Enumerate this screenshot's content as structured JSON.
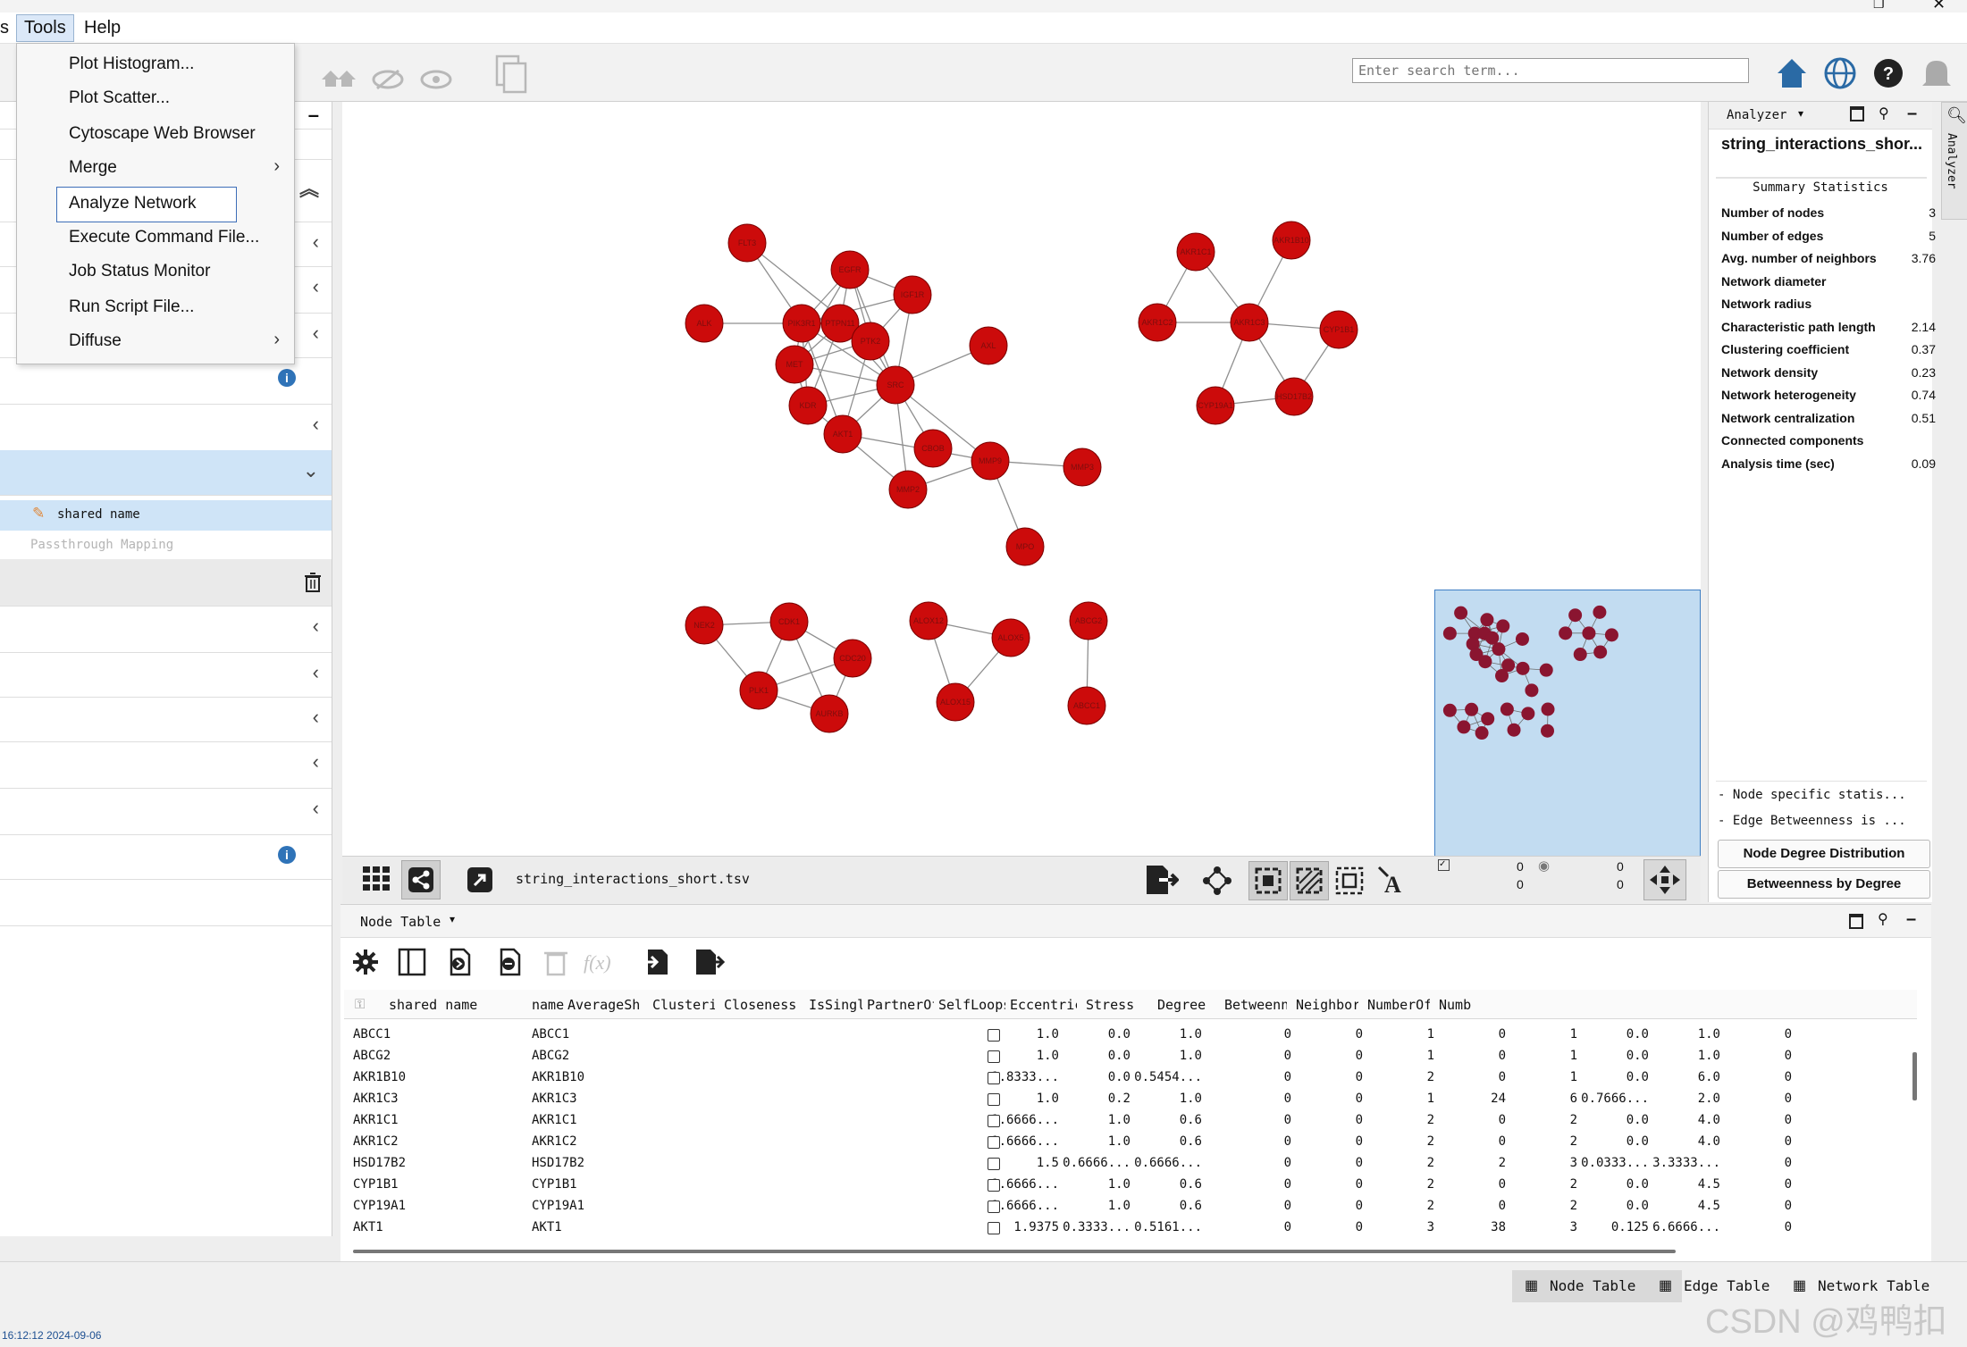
{
  "menubar": {
    "cut_item": "s",
    "tools": "Tools",
    "help": "Help"
  },
  "tools_menu": {
    "items": [
      {
        "label": "Plot Histogram..."
      },
      {
        "label": "Plot Scatter..."
      },
      {
        "label": "Cytoscape Web Browser"
      },
      {
        "label": "Merge"
      },
      {
        "label": "Analyze Network"
      },
      {
        "label": "Execute Command File..."
      },
      {
        "label": "Job Status Monitor"
      },
      {
        "label": "Run Script File..."
      },
      {
        "label": "Diffuse"
      }
    ]
  },
  "search": {
    "placeholder": "Enter search term..."
  },
  "left_panel": {
    "selected_column": "shared name",
    "mapping_type": "Passthrough Mapping"
  },
  "network": {
    "file_label": "string_interactions_short.tsv",
    "nodes": [
      {
        "id": "FLT3"
      },
      {
        "id": "EGFR"
      },
      {
        "id": "IGF1R"
      },
      {
        "id": "ALK"
      },
      {
        "id": "PIK3R1"
      },
      {
        "id": "PTPN11"
      },
      {
        "id": "PTK2"
      },
      {
        "id": "AXL"
      },
      {
        "id": "MET"
      },
      {
        "id": "SRC"
      },
      {
        "id": "KDR"
      },
      {
        "id": "AKT1"
      },
      {
        "id": "CBOB"
      },
      {
        "id": "MMP9"
      },
      {
        "id": "MMP2"
      },
      {
        "id": "MMP3"
      },
      {
        "id": "MPO"
      },
      {
        "id": "AKR1C1"
      },
      {
        "id": "AKR1B10"
      },
      {
        "id": "AKR1C2"
      },
      {
        "id": "AKR1C3"
      },
      {
        "id": "CYP1B1"
      },
      {
        "id": "CYP19A1"
      },
      {
        "id": "HSD17B2"
      },
      {
        "id": "NEK2"
      },
      {
        "id": "CDK1"
      },
      {
        "id": "CDC20"
      },
      {
        "id": "PLK1"
      },
      {
        "id": "AURKB"
      },
      {
        "id": "ALOX12"
      },
      {
        "id": "ALOX5"
      },
      {
        "id": "ALOX15"
      },
      {
        "id": "ABCG2"
      },
      {
        "id": "ABCC1"
      }
    ]
  },
  "analyzer": {
    "panel_title": "Analyzer",
    "network_name": "string_interactions_shor...",
    "summary_heading": "Summary Statistics",
    "stats": [
      {
        "label": "Number of nodes",
        "value": "3"
      },
      {
        "label": "Number of edges",
        "value": "5"
      },
      {
        "label": "Avg. number of neighbors",
        "value": "3.76"
      },
      {
        "label": "Network diameter",
        "value": ""
      },
      {
        "label": "Network radius",
        "value": ""
      },
      {
        "label": "Characteristic path length",
        "value": "2.14"
      },
      {
        "label": "Clustering coefficient",
        "value": "0.37"
      },
      {
        "label": "Network density",
        "value": "0.23"
      },
      {
        "label": "Network heterogeneity",
        "value": "0.74"
      },
      {
        "label": "Network centralization",
        "value": "0.51"
      },
      {
        "label": "Connected components",
        "value": ""
      },
      {
        "label": "Analysis time (sec)",
        "value": "0.09"
      }
    ],
    "note1": "- Node specific statis...",
    "note2": "- Edge Betweenness is ...",
    "btn_degree": "Node Degree Distribution",
    "btn_betweenness": "Betweenness by Degree",
    "side_tab": "Analyzer",
    "sel_nodes": "0",
    "sel_edges": "0",
    "hid_nodes": "0",
    "hid_edges": "0"
  },
  "node_table": {
    "title": "Node Table",
    "columns": [
      "shared name",
      "name",
      "AverageSho:",
      "Clustering(",
      "ClosenessC:",
      "IsSingleNo:",
      "PartnerOfM:",
      "SelfLoops",
      "Eccentrici:",
      "Stress",
      "Degree",
      "Betweennes:",
      "Neighborho:",
      "NumberOfDi:",
      "Numb"
    ],
    "rows": [
      [
        "ABCC1",
        "ABCC1",
        "1.0",
        "0.0",
        "1.0",
        "",
        "0",
        "0",
        "1",
        "0",
        "1",
        "0.0",
        "1.0",
        "0"
      ],
      [
        "ABCG2",
        "ABCG2",
        "1.0",
        "0.0",
        "1.0",
        "",
        "0",
        "0",
        "1",
        "0",
        "1",
        "0.0",
        "1.0",
        "0"
      ],
      [
        "AKR1B10",
        "AKR1B10",
        "1.8333...",
        "0.0",
        "0.5454...",
        "",
        "0",
        "0",
        "2",
        "0",
        "1",
        "0.0",
        "6.0",
        "0"
      ],
      [
        "AKR1C3",
        "AKR1C3",
        "1.0",
        "0.2",
        "1.0",
        "",
        "0",
        "0",
        "1",
        "24",
        "6",
        "0.7666...",
        "2.0",
        "0"
      ],
      [
        "AKR1C1",
        "AKR1C1",
        "1.6666...",
        "1.0",
        "0.6",
        "",
        "0",
        "0",
        "2",
        "0",
        "2",
        "0.0",
        "4.0",
        "0"
      ],
      [
        "AKR1C2",
        "AKR1C2",
        "1.6666...",
        "1.0",
        "0.6",
        "",
        "0",
        "0",
        "2",
        "0",
        "2",
        "0.0",
        "4.0",
        "0"
      ],
      [
        "HSD17B2",
        "HSD17B2",
        "1.5",
        "0.6666...",
        "0.6666...",
        "",
        "0",
        "0",
        "2",
        "2",
        "3",
        "0.0333...",
        "3.3333...",
        "0"
      ],
      [
        "CYP1B1",
        "CYP1B1",
        "1.6666...",
        "1.0",
        "0.6",
        "",
        "0",
        "0",
        "2",
        "0",
        "2",
        "0.0",
        "4.5",
        "0"
      ],
      [
        "CYP19A1",
        "CYP19A1",
        "1.6666...",
        "1.0",
        "0.6",
        "",
        "0",
        "0",
        "2",
        "0",
        "2",
        "0.0",
        "4.5",
        "0"
      ],
      [
        "AKT1",
        "AKT1",
        "1.9375",
        "0.3333...",
        "0.5161...",
        "",
        "0",
        "0",
        "3",
        "38",
        "3",
        "0.125",
        "6.6666...",
        "0"
      ]
    ]
  },
  "footer": {
    "tabs": [
      "Node Table",
      "Edge Table",
      "Network Table"
    ],
    "status_time": "16:12:12 2024-09-06",
    "watermark": "CSDN @鸡鸭扣"
  }
}
